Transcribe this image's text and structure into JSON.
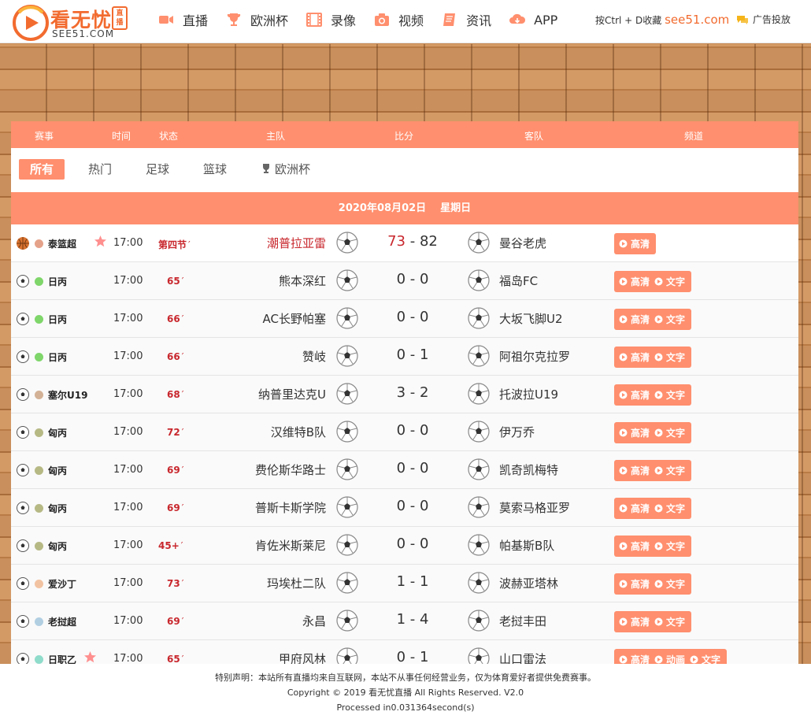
{
  "header": {
    "logo_title": "看无忧",
    "logo_tag": "直播",
    "logo_sub": "SEE51.COM",
    "nav": [
      {
        "label": "直播",
        "icon": "video-camera-icon"
      },
      {
        "label": "欧洲杯",
        "icon": "trophy-icon"
      },
      {
        "label": "录像",
        "icon": "film-icon"
      },
      {
        "label": "视频",
        "icon": "camera-icon"
      },
      {
        "label": "资讯",
        "icon": "notebook-icon"
      },
      {
        "label": "APP",
        "icon": "cloud-download-icon"
      }
    ],
    "bookmark_text": "按Ctrl + D收藏",
    "bookmark_site": "see51.com",
    "ad_label": "广告投放",
    "accent_color": "#f26b2f"
  },
  "table": {
    "columns": [
      "赛事",
      "时间",
      "状态",
      "主队",
      "比分",
      "客队",
      "频道"
    ],
    "filters": [
      "所有",
      "热门",
      "足球",
      "篮球",
      "欧洲杯"
    ],
    "date": "2020年08月02日",
    "weekday": "星期日",
    "header_color": "#ff8f6e"
  },
  "matches": [
    {
      "sport": "basketball",
      "league": "泰篮超",
      "dot": "#e5a28a",
      "star": true,
      "time": "17:00",
      "status": "第四节",
      "home": "潮普拉亚雷",
      "home_hl": true,
      "score_home": "73",
      "score_away": "82",
      "away": "曼谷老虎",
      "channels": [
        "高清"
      ]
    },
    {
      "sport": "football",
      "league": "日丙",
      "dot": "#7fd66a",
      "star": false,
      "time": "17:00",
      "status": "65",
      "home": "熊本深红",
      "home_hl": false,
      "score_home": "0",
      "score_away": "0",
      "away": "福岛FC",
      "channels": [
        "高清",
        "文字"
      ]
    },
    {
      "sport": "football",
      "league": "日丙",
      "dot": "#7fd66a",
      "star": false,
      "time": "17:00",
      "status": "66",
      "home": "AC长野帕塞",
      "home_hl": false,
      "score_home": "0",
      "score_away": "0",
      "away": "大坂飞脚U2",
      "channels": [
        "高清",
        "文字"
      ]
    },
    {
      "sport": "football",
      "league": "日丙",
      "dot": "#7fd66a",
      "star": false,
      "time": "17:00",
      "status": "66",
      "home": "赞岐",
      "home_hl": false,
      "score_home": "0",
      "score_away": "1",
      "away": "阿祖尔克拉罗",
      "channels": [
        "高清",
        "文字"
      ]
    },
    {
      "sport": "football",
      "league": "塞尔U19",
      "dot": "#d3b196",
      "star": false,
      "time": "17:00",
      "status": "68",
      "home": "纳普里达克U",
      "home_hl": false,
      "score_home": "3",
      "score_away": "2",
      "away": "托波拉U19",
      "channels": [
        "高清",
        "文字"
      ]
    },
    {
      "sport": "football",
      "league": "匈丙",
      "dot": "#b7b985",
      "star": false,
      "time": "17:00",
      "status": "72",
      "home": "汉维特B队",
      "home_hl": false,
      "score_home": "0",
      "score_away": "0",
      "away": "伊万乔",
      "channels": [
        "高清",
        "文字"
      ]
    },
    {
      "sport": "football",
      "league": "匈丙",
      "dot": "#b7b985",
      "star": false,
      "time": "17:00",
      "status": "69",
      "home": "费伦斯华路士",
      "home_hl": false,
      "score_home": "0",
      "score_away": "0",
      "away": "凯奇凯梅特",
      "channels": [
        "高清",
        "文字"
      ]
    },
    {
      "sport": "football",
      "league": "匈丙",
      "dot": "#b7b985",
      "star": false,
      "time": "17:00",
      "status": "69",
      "home": "普斯卡斯学院",
      "home_hl": false,
      "score_home": "0",
      "score_away": "0",
      "away": "莫索马格亚罗",
      "channels": [
        "高清",
        "文字"
      ]
    },
    {
      "sport": "football",
      "league": "匈丙",
      "dot": "#b7b985",
      "star": false,
      "time": "17:00",
      "status": "45+",
      "home": "肯佐米斯莱尼",
      "home_hl": false,
      "score_home": "0",
      "score_away": "0",
      "away": "帕基斯B队",
      "channels": [
        "高清",
        "文字"
      ]
    },
    {
      "sport": "football",
      "league": "爱沙丁",
      "dot": "#f2c3a2",
      "star": false,
      "time": "17:00",
      "status": "73",
      "home": "玛埃杜二队",
      "home_hl": false,
      "score_home": "1",
      "score_away": "1",
      "away": "波赫亚塔林",
      "channels": [
        "高清",
        "文字"
      ]
    },
    {
      "sport": "football",
      "league": "老挝超",
      "dot": "#b2cfe2",
      "star": false,
      "time": "17:00",
      "status": "69",
      "home": "永昌",
      "home_hl": false,
      "score_home": "1",
      "score_away": "4",
      "away": "老挝丰田",
      "channels": [
        "高清",
        "文字"
      ]
    },
    {
      "sport": "football",
      "league": "日职乙",
      "dot": "#8fdccb",
      "star": true,
      "time": "17:00",
      "status": "65",
      "home": "甲府风林",
      "home_hl": false,
      "score_home": "0",
      "score_away": "1",
      "away": "山口雷法",
      "channels": [
        "高清",
        "动画",
        "文字"
      ]
    }
  ],
  "footer": {
    "disclaimer": "特别声明：本站所有直播均来自互联网，本站不从事任何经营业务，仅为体育爱好者提供免费赛事。",
    "copyright": "Copyright © 2019 看无忧直播 All Rights Reserved. V2.0",
    "processed": "Processed in0.031364second(s)"
  }
}
